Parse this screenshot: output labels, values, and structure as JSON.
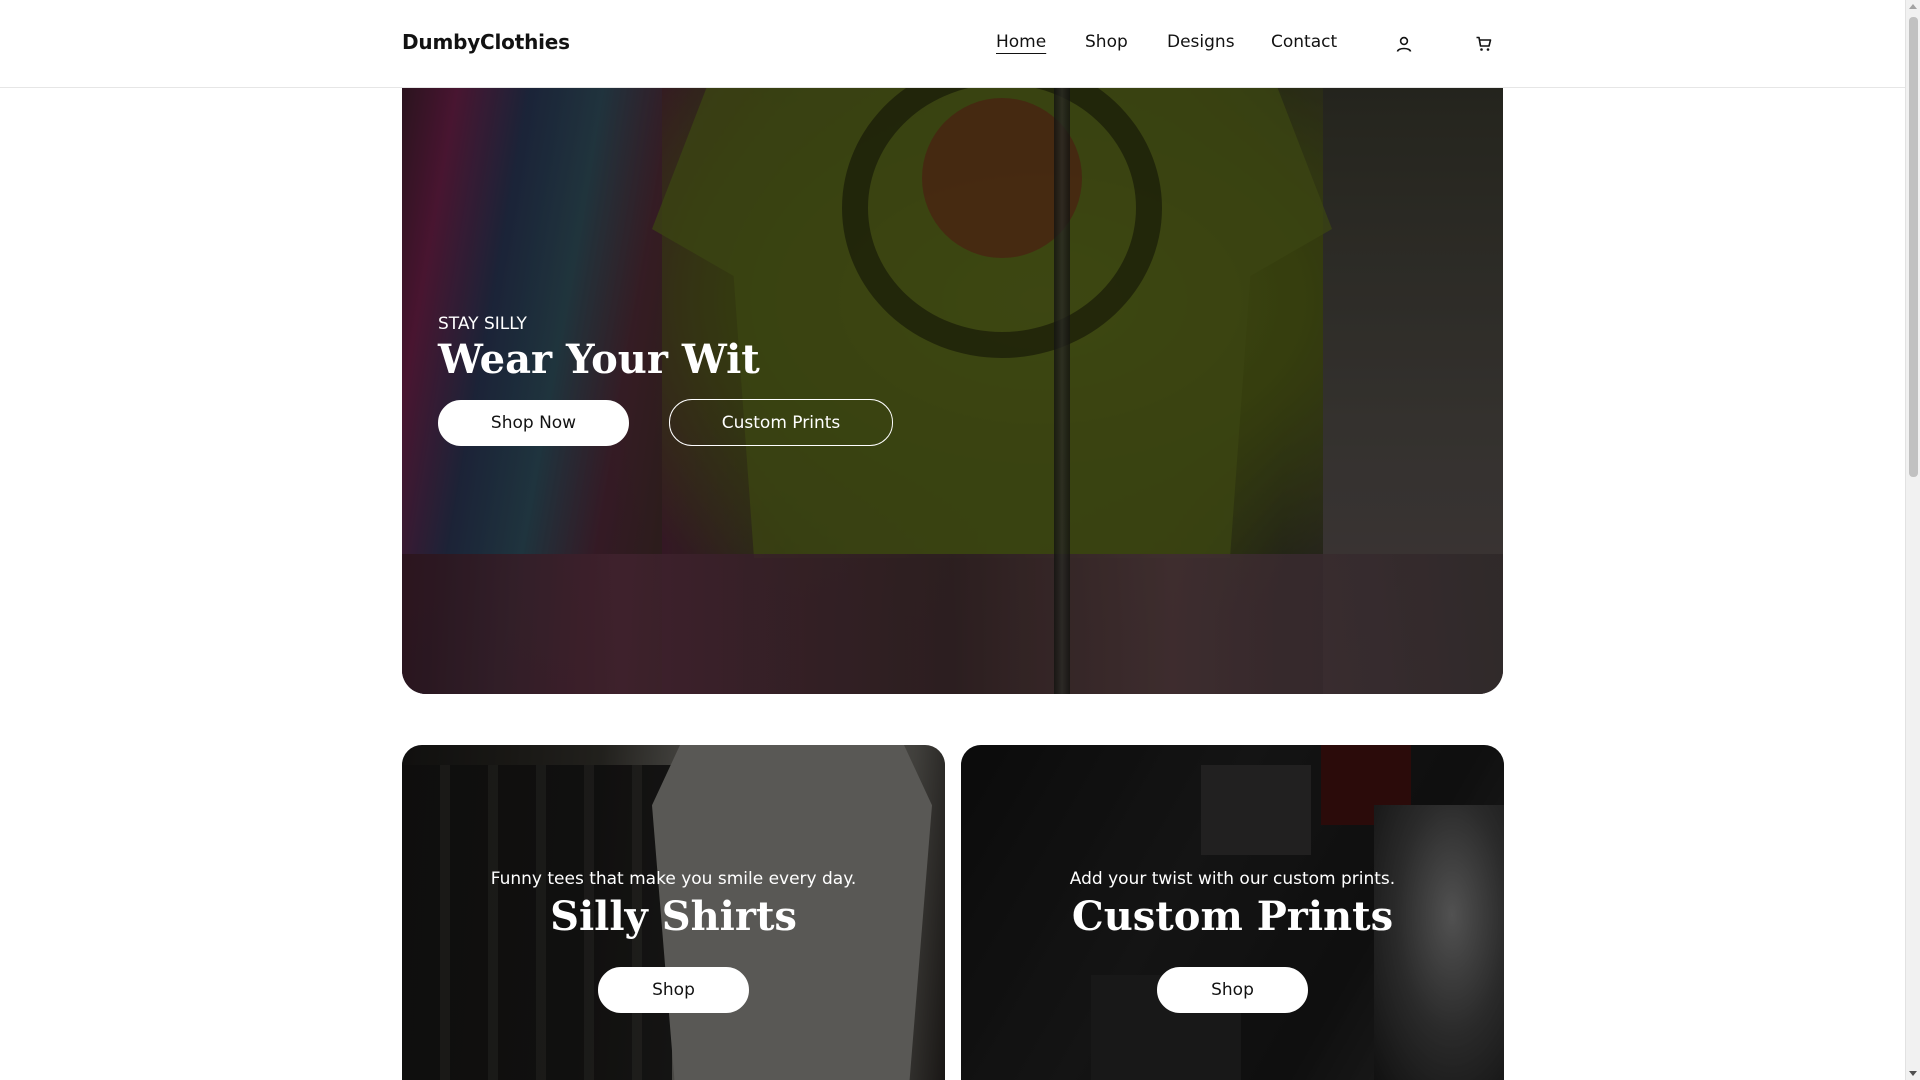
{
  "header": {
    "logo": "DumbyClothies",
    "nav": [
      {
        "label": "Home",
        "active": true
      },
      {
        "label": "Shop",
        "active": false
      },
      {
        "label": "Designs",
        "active": false
      },
      {
        "label": "Contact",
        "active": false
      }
    ],
    "icons": [
      "account-icon",
      "cart-icon"
    ]
  },
  "hero": {
    "eyebrow": "STAY SILLY",
    "title": "Wear Your Wit",
    "primary_button": "Shop Now",
    "secondary_button": "Custom Prints"
  },
  "collections": [
    {
      "description": "Funny tees that make you smile every day.",
      "title": "Silly Shirts",
      "button": "Shop"
    },
    {
      "description": "Add your twist with our custom prints.",
      "title": "Custom Prints",
      "button": "Shop"
    }
  ],
  "colors": {
    "text": "#121212",
    "background": "#ffffff",
    "overlay_text": "#ffffff"
  }
}
